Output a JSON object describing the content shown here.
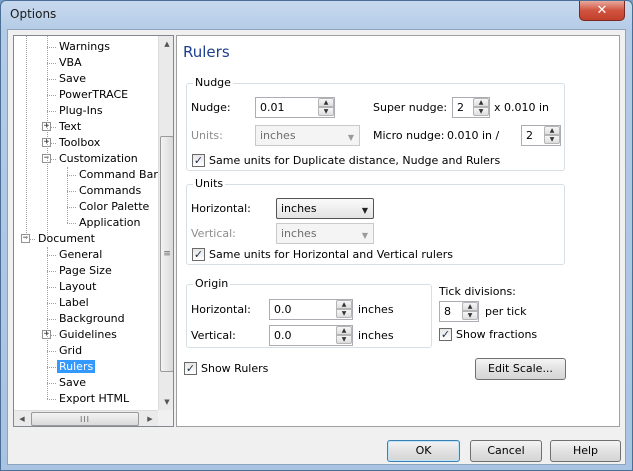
{
  "window": {
    "title": "Options",
    "close_glyph": "✕"
  },
  "tree": {
    "items": [
      {
        "label": "Warnings",
        "level": 2
      },
      {
        "label": "VBA",
        "level": 2
      },
      {
        "label": "Save",
        "level": 2
      },
      {
        "label": "PowerTRACE",
        "level": 2
      },
      {
        "label": "Plug-Ins",
        "level": 2
      },
      {
        "label": "Text",
        "level": 2,
        "expander": "+"
      },
      {
        "label": "Toolbox",
        "level": 2,
        "expander": "+"
      },
      {
        "label": "Customization",
        "level": 2,
        "expander": "−"
      },
      {
        "label": "Command Bars",
        "level": 3
      },
      {
        "label": "Commands",
        "level": 3
      },
      {
        "label": "Color Palette",
        "level": 3
      },
      {
        "label": "Application",
        "level": 3
      },
      {
        "label": "Document",
        "level": 1,
        "expander": "−"
      },
      {
        "label": "General",
        "level": 2
      },
      {
        "label": "Page Size",
        "level": 2
      },
      {
        "label": "Layout",
        "level": 2
      },
      {
        "label": "Label",
        "level": 2
      },
      {
        "label": "Background",
        "level": 2
      },
      {
        "label": "Guidelines",
        "level": 2,
        "expander": "+"
      },
      {
        "label": "Grid",
        "level": 2
      },
      {
        "label": "Rulers",
        "level": 2,
        "selected": true
      },
      {
        "label": "Save",
        "level": 2
      },
      {
        "label": "Export HTML",
        "level": 2
      }
    ],
    "hscroll_grip": "III",
    "vscroll_grip": "≡"
  },
  "panel": {
    "title": "Rulers",
    "nudge": {
      "group_label": "Nudge",
      "nudge_label": "Nudge:",
      "nudge_value": "0.01",
      "super_nudge_label": "Super nudge:",
      "super_nudge_value": "2",
      "super_nudge_suffix": "x 0.010 in",
      "units_label": "Units:",
      "units_value": "inches",
      "micro_nudge_label": "Micro nudge:",
      "micro_nudge_prefix": "0.010 in /",
      "micro_nudge_value": "2",
      "same_units_label": "Same units for Duplicate distance, Nudge and Rulers",
      "same_units_checked": true
    },
    "units": {
      "group_label": "Units",
      "horizontal_label": "Horizontal:",
      "horizontal_value": "inches",
      "vertical_label": "Vertical:",
      "vertical_value": "inches",
      "same_units_label": "Same units for Horizontal and Vertical rulers",
      "same_units_checked": true
    },
    "origin": {
      "group_label": "Origin",
      "horizontal_label": "Horizontal:",
      "horizontal_value": "0.0",
      "horizontal_unit": "inches",
      "vertical_label": "Vertical:",
      "vertical_value": "0.0",
      "vertical_unit": "inches"
    },
    "tick": {
      "label": "Tick divisions:",
      "value": "8",
      "suffix": "per tick",
      "show_fractions_label": "Show fractions",
      "show_fractions_checked": true
    },
    "show_rulers_label": "Show Rulers",
    "show_rulers_checked": true,
    "edit_scale_label": "Edit Scale..."
  },
  "footer": {
    "ok_label": "OK",
    "cancel_label": "Cancel",
    "help_label": "Help"
  },
  "glyphs": {
    "check": "✓",
    "up": "▲",
    "down": "▼",
    "left": "◀",
    "right": "▶"
  }
}
